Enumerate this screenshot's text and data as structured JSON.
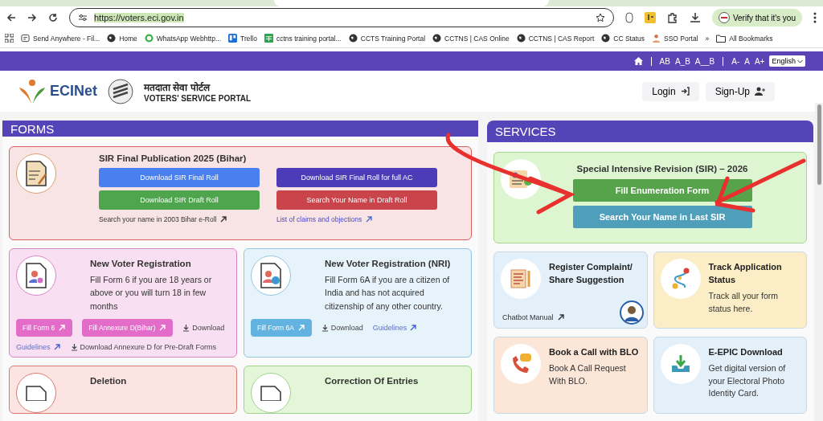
{
  "browser": {
    "url": "https://voters.eci.gov.in",
    "verify_button": "Verify that it's you",
    "bookmarks": [
      {
        "kind": "page",
        "label": "Send Anywhere - Fil..."
      },
      {
        "kind": "globe",
        "label": "Home"
      },
      {
        "kind": "chat",
        "label": "WhatsApp Webhttp..."
      },
      {
        "kind": "board",
        "label": "Trello"
      },
      {
        "kind": "sheet",
        "label": "cctns training portal..."
      },
      {
        "kind": "globe",
        "label": "CCTS Training Portal"
      },
      {
        "kind": "globe",
        "label": "CCTNS | CAS Online"
      },
      {
        "kind": "globe",
        "label": "CCTNS | CAS Report"
      },
      {
        "kind": "globe",
        "label": "CC Status"
      },
      {
        "kind": "person",
        "label": "SSO Portal"
      }
    ],
    "more": "»",
    "all_bookmarks": "All Bookmarks"
  },
  "top_bar": {
    "contrast": [
      "AB",
      "A_B",
      "A__B"
    ],
    "font_sizes": [
      "A-",
      "A",
      "A+"
    ],
    "language": "English"
  },
  "header": {
    "logo": "ECINet",
    "portal_hindi": "मतदाता सेवा पोर्टल",
    "portal_title": "VOTERS' SERVICE PORTAL",
    "login": "Login",
    "signup": "Sign-Up"
  },
  "forms": {
    "title": "FORMS",
    "sir_card": {
      "title": "SIR Final Publication 2025 (Bihar)",
      "buttons": [
        {
          "label": "Download SIR Final Roll",
          "color": "#4a7ff0"
        },
        {
          "label": "Download SIR Final Roll for full AC",
          "color": "#4d3cb8"
        },
        {
          "label": "Download SIR Draft Roll",
          "color": "#4fa54d"
        },
        {
          "label": "Search Your Name in Draft Roll",
          "color": "#c9444b"
        }
      ],
      "links": [
        "Search your name in 2003 Bihar e-Roll",
        "List of claims and objections"
      ]
    },
    "cards": [
      {
        "title": "New Voter Registration",
        "description": "Fill Form 6 if you are 18 years or above or you will turn 18 in few months",
        "color": "#f8e0f2",
        "actions": [
          {
            "kind": "button",
            "label": "Fill Form 6",
            "color": "#e26cc8"
          },
          {
            "kind": "button",
            "label": "Fill Annexure D(Bihar)",
            "color": "#e26cc8"
          },
          {
            "kind": "download",
            "label": "Download"
          },
          {
            "kind": "link",
            "label": "Guidelines"
          },
          {
            "kind": "download",
            "label": "Download Annexure D for Pre-Draft Forms"
          }
        ]
      },
      {
        "title": "New Voter Registration (NRI)",
        "description": "Fill Form 6A if you are a citizen of India and has not acquired citizenship of any other country.",
        "color": "#e6f3fb",
        "actions": [
          {
            "kind": "button",
            "label": "Fill Form 6A",
            "color": "#62b3e0"
          },
          {
            "kind": "download",
            "label": "Download"
          },
          {
            "kind": "link",
            "label": "Guidelines"
          }
        ]
      },
      {
        "title": "Deletion",
        "color": "#fbe4e2"
      },
      {
        "title": "Correction Of Entries",
        "color": "#e3f6d8"
      }
    ]
  },
  "services": {
    "title": "SERVICES",
    "sir_card": {
      "title": "Special Intensive Revision (SIR) – 2026",
      "buttons": [
        {
          "label": "Fill Enumeration Form",
          "color": "#56a34b"
        },
        {
          "label": "Search Your Name in Last SIR",
          "color": "#4f9fba"
        }
      ]
    },
    "cards": [
      {
        "title": "Register Complaint/ Share Suggestion",
        "link": "Chatbot Manual",
        "color": "#e3f0fa"
      },
      {
        "title": "Track Application Status",
        "description": "Track all your form status here.",
        "color": "#fbedc6"
      },
      {
        "title": "Book a Call with BLO",
        "description": "Book A Call Request With BLO.",
        "color": "#fbe6d8"
      },
      {
        "title": "E-EPIC Download",
        "description": "Get digital version of your Electoral Photo Identity Card.",
        "color": "#e3f0fa"
      }
    ]
  }
}
